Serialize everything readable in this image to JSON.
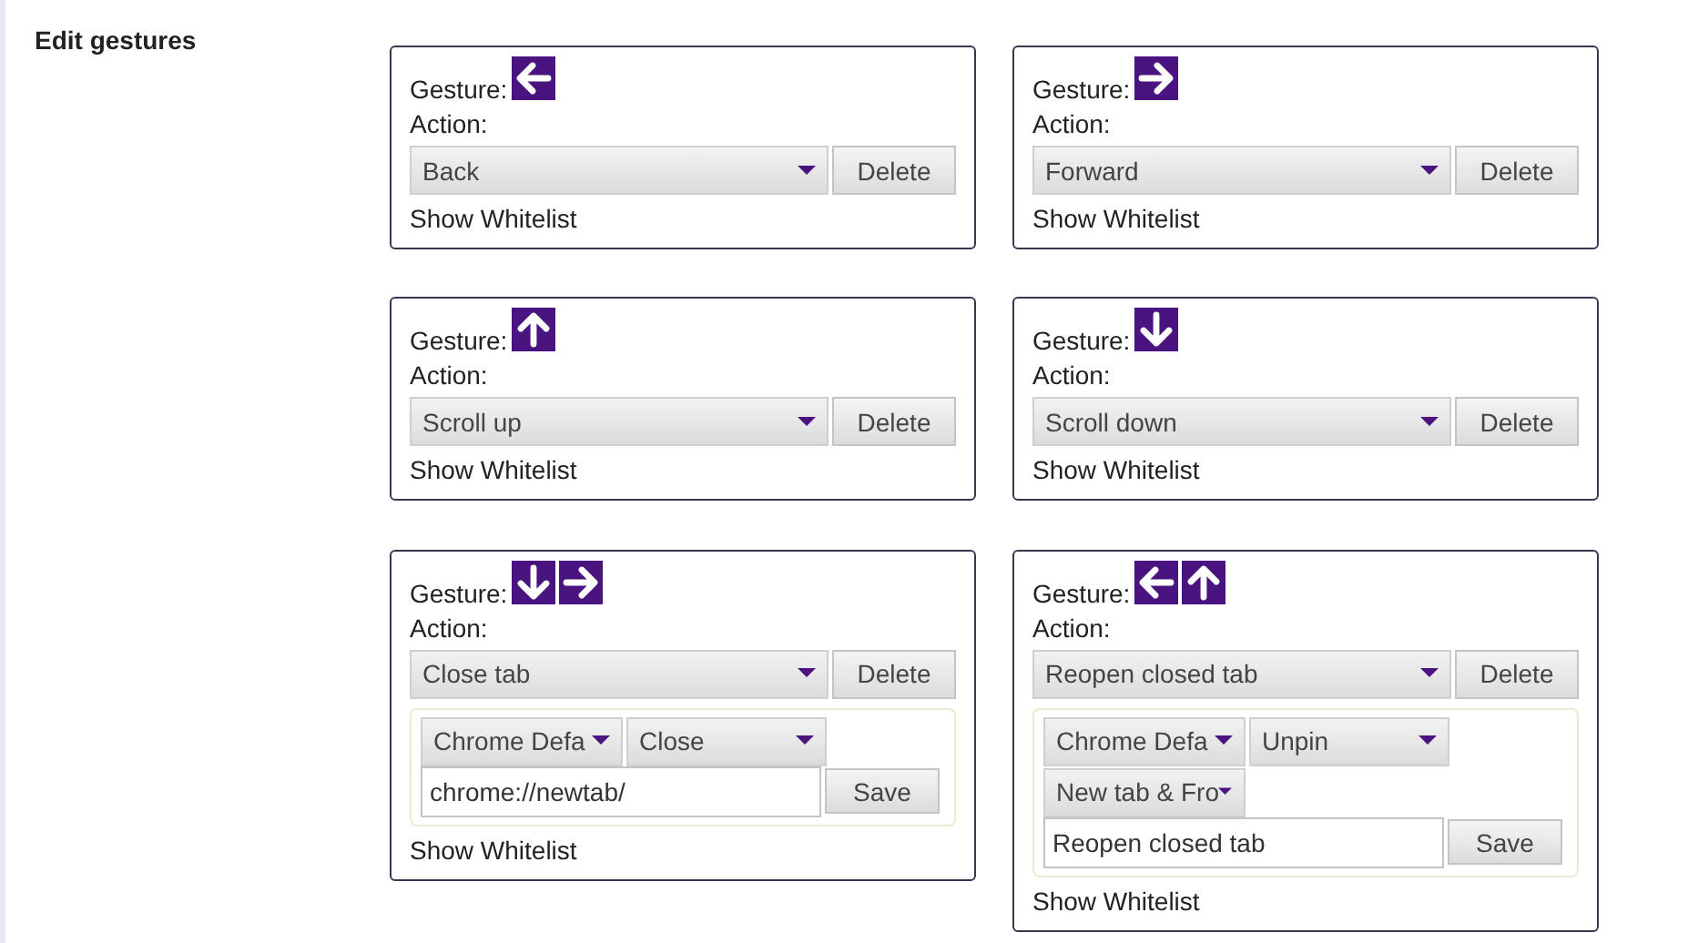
{
  "heading": "Edit gestures",
  "gestures": [
    {
      "gesture_label": "Gesture:",
      "directions": [
        {
          "kind": "left"
        }
      ],
      "action_label": "Action:",
      "action": "Back",
      "delete": "Delete",
      "show_whitelist": "Show Whitelist"
    },
    {
      "gesture_label": "Gesture:",
      "directions": [
        {
          "kind": "right"
        }
      ],
      "action_label": "Action:",
      "action": "Forward",
      "delete": "Delete",
      "show_whitelist": "Show Whitelist"
    },
    {
      "gesture_label": "Gesture:",
      "directions": [
        {
          "kind": "up"
        }
      ],
      "action_label": "Action:",
      "action": "Scroll up",
      "delete": "Delete",
      "show_whitelist": "Show Whitelist"
    },
    {
      "gesture_label": "Gesture:",
      "directions": [
        {
          "kind": "down"
        }
      ],
      "action_label": "Action:",
      "action": "Scroll down",
      "delete": "Delete",
      "show_whitelist": "Show Whitelist"
    },
    {
      "gesture_label": "Gesture:",
      "directions": [
        {
          "kind": "down"
        },
        {
          "kind": "right"
        }
      ],
      "action_label": "Action:",
      "action": "Close tab",
      "delete": "Delete",
      "options": {
        "dropdowns": [
          "Chrome Defa",
          "Close"
        ],
        "value": "chrome://newtab/",
        "save": "Save"
      },
      "show_whitelist": "Show Whitelist"
    },
    {
      "gesture_label": "Gesture:",
      "directions": [
        {
          "kind": "left"
        },
        {
          "kind": "up"
        }
      ],
      "action_label": "Action:",
      "action": "Reopen closed tab",
      "delete": "Delete",
      "options": {
        "dropdowns": [
          "Chrome Defa",
          "Unpin",
          "New tab & Fro"
        ],
        "value": "Reopen closed tab",
        "save": "Save"
      },
      "show_whitelist": "Show Whitelist"
    }
  ]
}
